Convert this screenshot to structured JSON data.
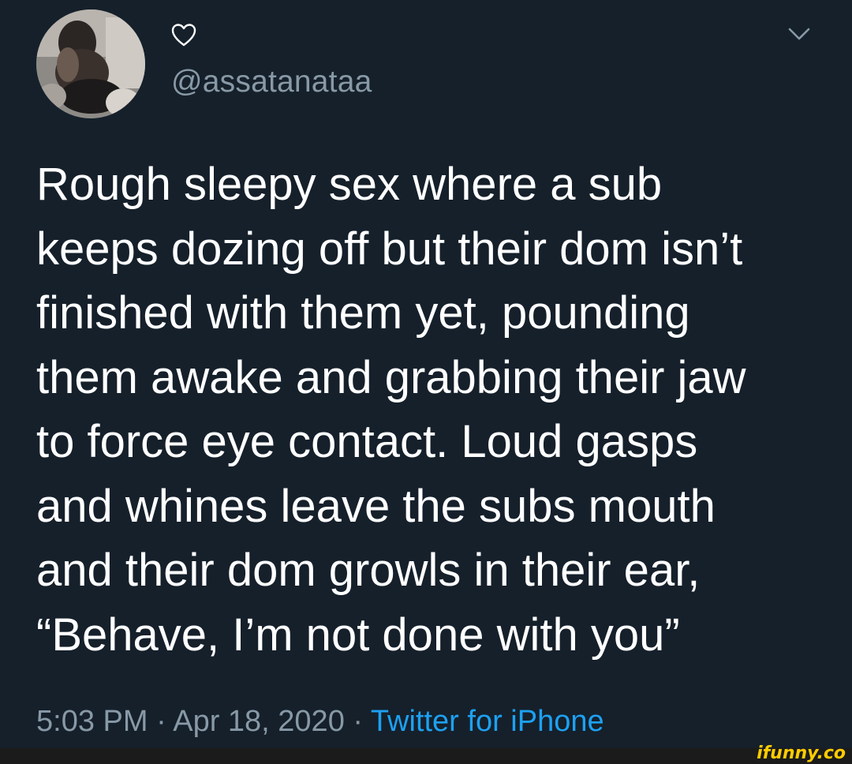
{
  "tweet": {
    "handle": "@assatanataa",
    "text": "Rough sleepy sex where a sub\nkeeps dozing off but their dom isn’t\nfinished with them yet, pounding\nthem awake and grabbing their jaw\nto force eye contact. Loud gasps\nand whines leave the subs mouth\nand their dom growls in their ear,\n“Behave, I’m not done with you”",
    "time": "5:03 PM",
    "separator": " · ",
    "date": "Apr 18, 2020",
    "source": "Twitter for iPhone"
  },
  "icons": {
    "heart": "heart-icon",
    "chevron": "chevron-down-icon"
  },
  "watermark": "ifunny.co",
  "colors": {
    "background": "#15202b",
    "text": "#ffffff",
    "muted": "#8899a6",
    "link": "#1da1f2",
    "watermark": "#ffcc00"
  }
}
